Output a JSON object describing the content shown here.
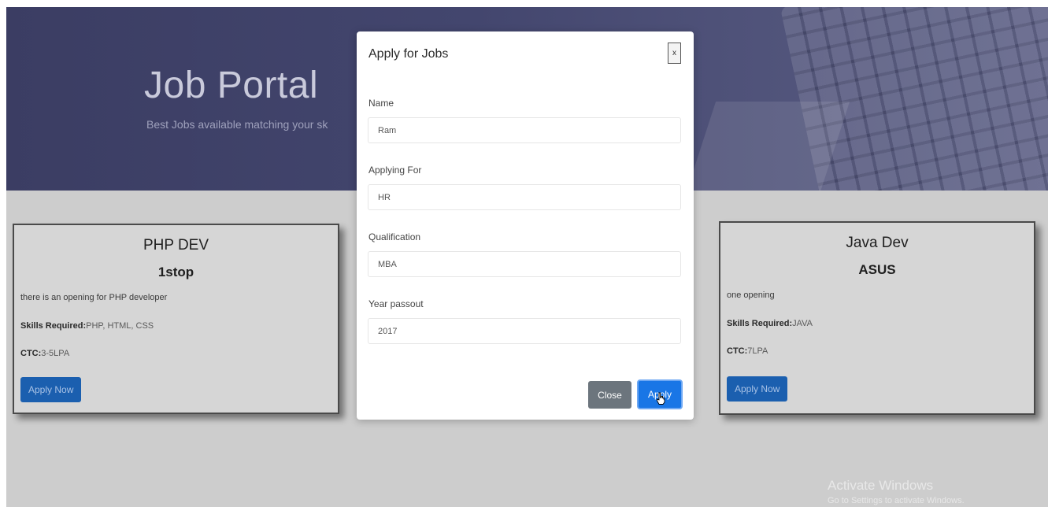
{
  "hero": {
    "title": "Job Portal",
    "subtitle": "Best Jobs available matching your sk"
  },
  "jobs": [
    {
      "title": "PHP DEV",
      "company": "1stop",
      "description": "there is an opening for PHP developer",
      "skills_label": "Skills Required:",
      "skills": "PHP, HTML, CSS",
      "ctc_label": "CTC:",
      "ctc": "3-5LPA",
      "button": "Apply Now"
    },
    {
      "title": "Java Dev",
      "company": "ASUS",
      "description": "one opening",
      "skills_label": "Skills Required:",
      "skills": "JAVA",
      "ctc_label": "CTC:",
      "ctc": "7LPA",
      "button": "Apply Now"
    }
  ],
  "modal": {
    "title": "Apply for Jobs",
    "close_icon": "x",
    "fields": [
      {
        "label": "Name",
        "value": "Ram"
      },
      {
        "label": "Applying For",
        "value": "HR"
      },
      {
        "label": "Qualification",
        "value": "MBA"
      },
      {
        "label": "Year passout",
        "value": "2017"
      }
    ],
    "close_button": "Close",
    "apply_button": "Apply"
  },
  "watermark": {
    "line1": "Activate Windows",
    "line2": "Go to Settings to activate Windows."
  },
  "colors": {
    "primary": "#1976e6",
    "secondary": "#6c757d",
    "hero_bg": "#43466e"
  }
}
